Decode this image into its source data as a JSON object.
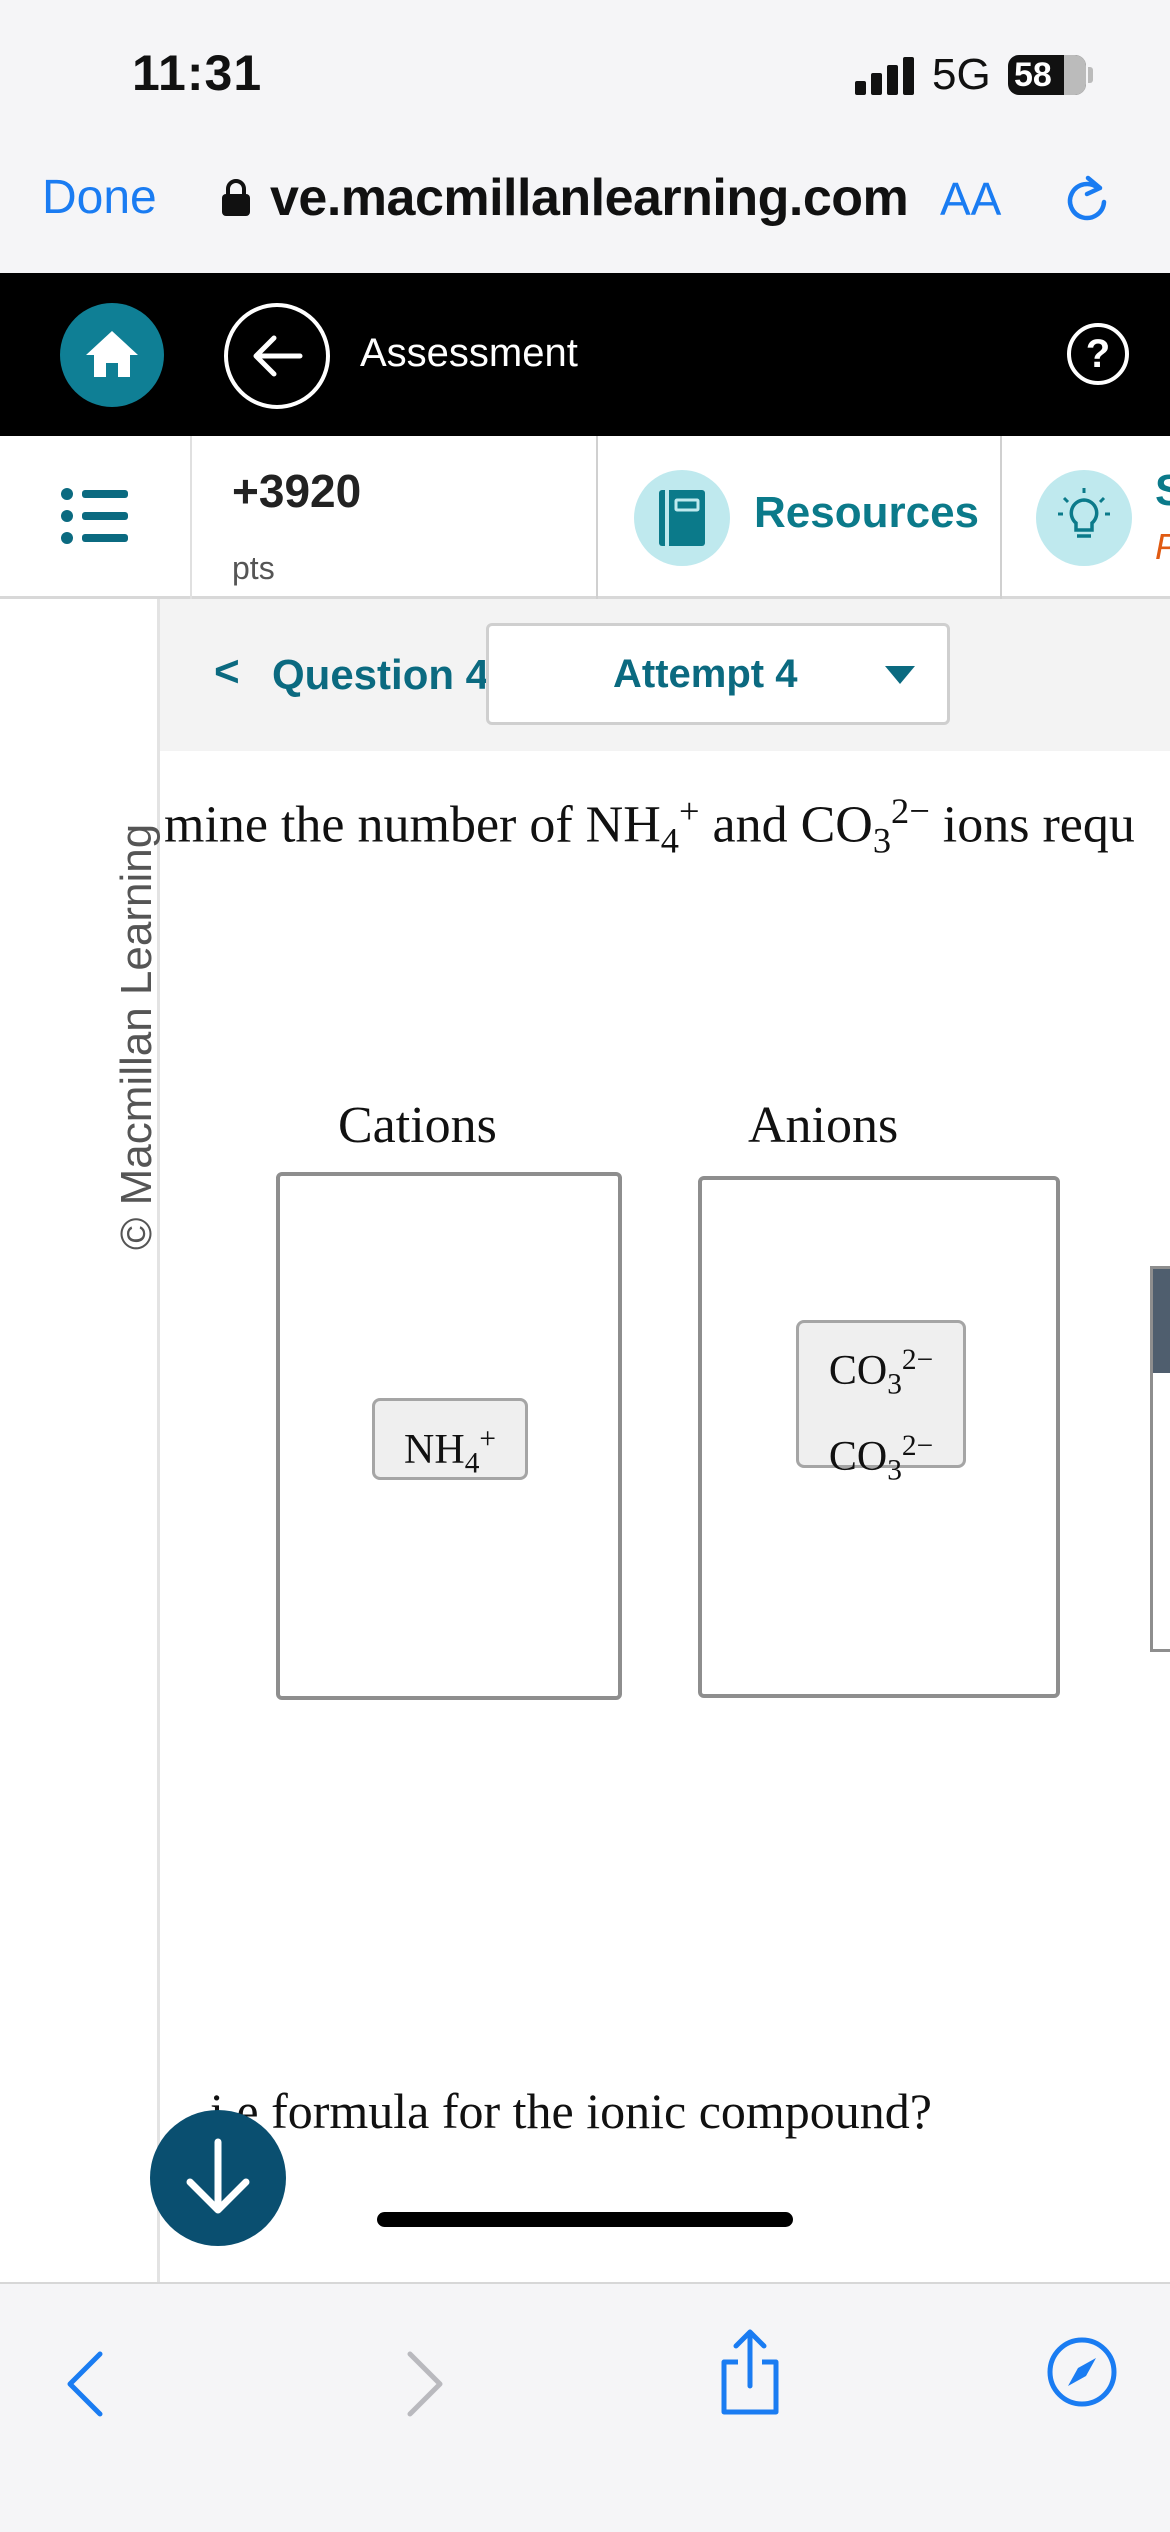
{
  "status": {
    "time": "11:31",
    "network": "5G",
    "battery": "58"
  },
  "browser": {
    "done_label": "Done",
    "url": "ve.macmillanlearning.com",
    "aa_label": "AA"
  },
  "header": {
    "title": "Assessment",
    "help": "?"
  },
  "toolbar": {
    "points_value": "+3920",
    "points_label": "pts",
    "resources_label": "Resources",
    "cut_s": "S",
    "cut_p": "P"
  },
  "sidebar": {
    "copyright": "© Macmillan Learning"
  },
  "question_nav": {
    "back_glyph": "<",
    "question_label": "Question 4",
    "attempt_label": "Attempt 4"
  },
  "question": {
    "part1": "mine the number of NH",
    "nh_sub": "4",
    "nh_sup": "+",
    "part2": " and CO",
    "co_sub": "3",
    "co_sup": "2−",
    "part3": " ions requ"
  },
  "bins": {
    "cations_title": "Cations",
    "anions_title": "Anions",
    "cation_chip": {
      "base": "NH",
      "sub": "4",
      "sup": "+"
    },
    "anion_chip": [
      {
        "base": "CO",
        "sub": "3",
        "sup": "2−"
      },
      {
        "base": "CO",
        "sub": "3",
        "sup": "2−"
      }
    ]
  },
  "question2": {
    "text": "i  e formula for the ionic compound?"
  },
  "colors": {
    "accent": "#0b6a80",
    "home": "#0f7f95",
    "link": "#1a7cf2",
    "scroll_btn": "#0a4f70"
  },
  "icons": {
    "lock": "lock-icon",
    "reload": "reload-icon",
    "home": "home-icon",
    "back": "arrow-left-icon",
    "help": "question-circle-icon",
    "menu": "list-icon",
    "resources": "book-icon",
    "hint": "lightbulb-icon",
    "scroll": "arrow-down-icon",
    "share": "share-icon",
    "compass": "compass-icon"
  }
}
